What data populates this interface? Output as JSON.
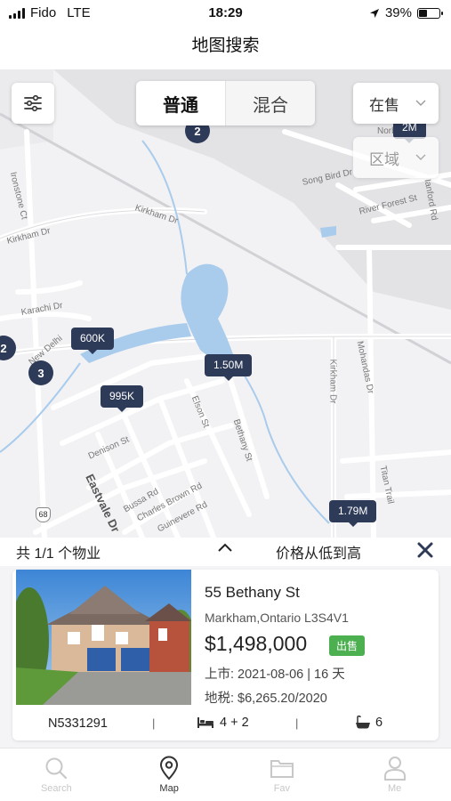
{
  "status_bar": {
    "carrier": "Fido",
    "network": "LTE",
    "time": "18:29",
    "battery_percent": "39%",
    "battery_level": 0.39
  },
  "header": {
    "title": "地图搜索"
  },
  "map": {
    "modes": [
      {
        "label": "普通",
        "active": true
      },
      {
        "label": "混合",
        "active": false
      }
    ],
    "status_dropdown": {
      "value": "在售"
    },
    "area_dropdown": {
      "value": "区域"
    },
    "price_pins": [
      "600K",
      "1.50M",
      "995K",
      "1.79M",
      "2M"
    ],
    "clusters": [
      "2",
      "2",
      "3"
    ],
    "highway_shield": "68",
    "streets": [
      "Ironstone Ct",
      "Kirkham Dr",
      "Kirkham Dr",
      "Karachi Dr",
      "New Delhi",
      "Song Bird Dr",
      "River Forest St",
      "Denison St",
      "Eastvale Dr",
      "Elson St",
      "Bethany St",
      "Bussa Rd",
      "Charles Brown Rd",
      "Guinevere Rd",
      "Kirkham Dr",
      "Mohandas Dr",
      "Titan Trail",
      "Norbur",
      "Ianford Rd"
    ],
    "colors": {
      "land": "#f2f2f4",
      "water": "#a9cbec",
      "road": "#ffffff",
      "pin": "#2d3a58"
    }
  },
  "results": {
    "count_label": "共 1/1 个物业",
    "sort_label": "价格从低到高",
    "listing": {
      "address": "55 Bethany St",
      "city": "Markham,Ontario L3S4V1",
      "price": "$1,498,000",
      "badge": "出售",
      "listed": "上市: 2021-08-06 | 16 天",
      "tax": "地税: $6,265.20/2020",
      "mls": "N5331291",
      "beds": "4 + 2",
      "baths": "6",
      "badge_color": "#4caf50"
    }
  },
  "tabs": [
    {
      "label": "Search",
      "icon": "search-icon",
      "active": false
    },
    {
      "label": "Map",
      "icon": "map-pin-icon",
      "active": true
    },
    {
      "label": "Fav",
      "icon": "folder-icon",
      "active": false
    },
    {
      "label": "Me",
      "icon": "person-icon",
      "active": false
    }
  ]
}
